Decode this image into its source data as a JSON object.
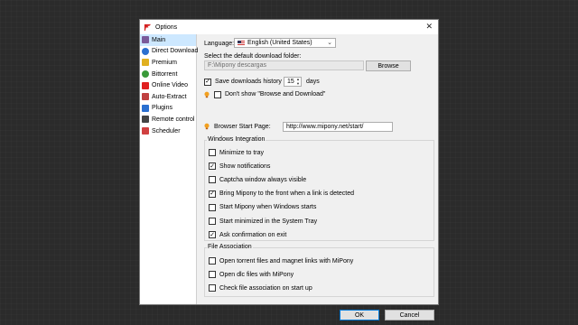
{
  "window": {
    "title": "Options",
    "close_glyph": "✕"
  },
  "sidebar": {
    "items": [
      {
        "label": "Main",
        "icon": "gear-icon",
        "color": "#7a5a9a"
      },
      {
        "label": "Direct Download",
        "icon": "globe-icon",
        "color": "#2a6fd0"
      },
      {
        "label": "Premium",
        "icon": "crown-icon",
        "color": "#e0b020"
      },
      {
        "label": "Bittorrent",
        "icon": "torrent-icon",
        "color": "#3a9a3a"
      },
      {
        "label": "Online Video",
        "icon": "youtube-icon",
        "color": "#e02020"
      },
      {
        "label": "Auto-Extract",
        "icon": "archive-icon",
        "color": "#c04040"
      },
      {
        "label": "Plugins",
        "icon": "plugin-icon",
        "color": "#2a6fd0"
      },
      {
        "label": "Remote control",
        "icon": "remote-icon",
        "color": "#444444"
      },
      {
        "label": "Scheduler",
        "icon": "calendar-icon",
        "color": "#d04040"
      }
    ]
  },
  "main": {
    "language_label": "Language:",
    "language_value": "English (United States)",
    "folder_label": "Select the default download folder:",
    "folder_value": "F:\\Mipony descargas",
    "browse_label": "Browse",
    "history_label": "Save downloads history for",
    "history_days": "15",
    "history_unit": "days",
    "dont_show_label": "Don't show \"Browse and Download\"",
    "start_page_label": "Browser Start Page:",
    "start_page_value": "http://www.mipony.net/start/",
    "windows_group_title": "Windows Integration",
    "windows_options": [
      {
        "label": "Minimize to tray",
        "checked": false
      },
      {
        "label": "Show notifications",
        "checked": true
      },
      {
        "label": "Captcha window always visible",
        "checked": false
      },
      {
        "label": "Bring Mipony to the front when a link is detected",
        "checked": true
      },
      {
        "label": "Start Mipony when Windows starts",
        "checked": false
      },
      {
        "label": "Start minimized in the System Tray",
        "checked": false
      },
      {
        "label": "Ask confirmation on exit",
        "checked": true
      }
    ],
    "file_group_title": "File Association",
    "file_options": [
      {
        "label": "Open torrent files and magnet links with MiPony",
        "checked": false
      },
      {
        "label": "Open dlc files with MiPony",
        "checked": false
      },
      {
        "label": "Check file association on start up",
        "checked": false
      }
    ]
  },
  "footer": {
    "ok_label": "OK",
    "cancel_label": "Cancel"
  },
  "colors": {
    "accent": "#0078d7",
    "selection": "#cde8ff",
    "brand": "#d42020"
  }
}
